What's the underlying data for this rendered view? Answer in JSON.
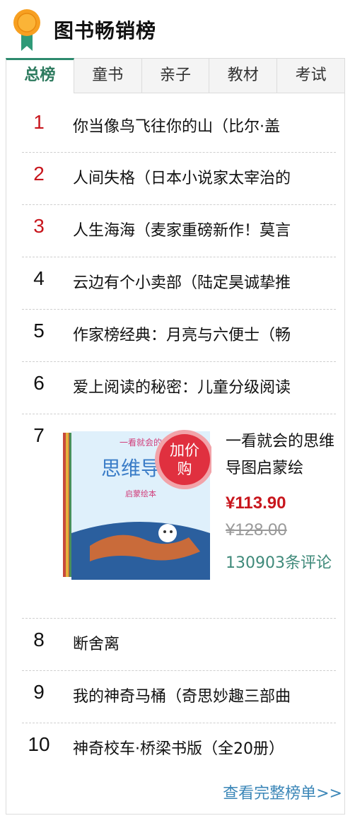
{
  "header": {
    "title": "图书畅销榜",
    "icon": "medal-icon"
  },
  "tabs": [
    {
      "label": "总榜",
      "active": true
    },
    {
      "label": "童书"
    },
    {
      "label": "亲子"
    },
    {
      "label": "教材"
    },
    {
      "label": "考试"
    }
  ],
  "items": [
    {
      "rank": "1",
      "title": "你当像鸟飞往你的山（比尔·盖"
    },
    {
      "rank": "2",
      "title": "人间失格（日本小说家太宰治的"
    },
    {
      "rank": "3",
      "title": "人生海海（麦家重磅新作！莫言"
    },
    {
      "rank": "4",
      "title": "云边有个小卖部（陆定昊诚挚推"
    },
    {
      "rank": "5",
      "title": "作家榜经典：月亮与六便士（畅"
    },
    {
      "rank": "6",
      "title": "爱上阅读的秘密：儿童分级阅读"
    },
    {
      "rank": "8",
      "title": "断舍离"
    },
    {
      "rank": "9",
      "title": "我的神奇马桶（奇思妙趣三部曲"
    },
    {
      "rank": "10",
      "title": "神奇校车·桥梁书版（全20册）"
    }
  ],
  "featured": {
    "rank": "7",
    "title": "一看就会的思维导图启蒙绘",
    "price": "¥113.90",
    "old_price": "¥128.00",
    "reviews": "130903条评论",
    "badge": "加价购",
    "cover_text": "思维导图",
    "cover_top": "一看就会的",
    "cover_sub": "启蒙绘本"
  },
  "footer": {
    "more_link": "查看完整榜单>>"
  },
  "colors": {
    "accent": "#2d8a6e",
    "rank_top": "#c8161d",
    "link": "#3c87b8",
    "reviews": "#3f8a7a",
    "badge": "#e0303f"
  }
}
